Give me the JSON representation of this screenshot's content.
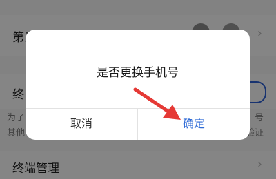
{
  "background": {
    "third_party_label": "第三方账号绑定",
    "terminal_label": "终",
    "desc_line1_left": "为了",
    "desc_line1_right": "号",
    "desc_line2_left": "其他",
    "desc_line2_right": "验证",
    "terminal_manage_label": "终端管理",
    "chevron": "›"
  },
  "dialog": {
    "title": "是否更换手机号",
    "cancel_label": "取消",
    "confirm_label": "确定"
  },
  "colors": {
    "accent": "#2f6bd6",
    "arrow": "#e53935",
    "overlay": "rgba(0,0,0,0.48)"
  }
}
